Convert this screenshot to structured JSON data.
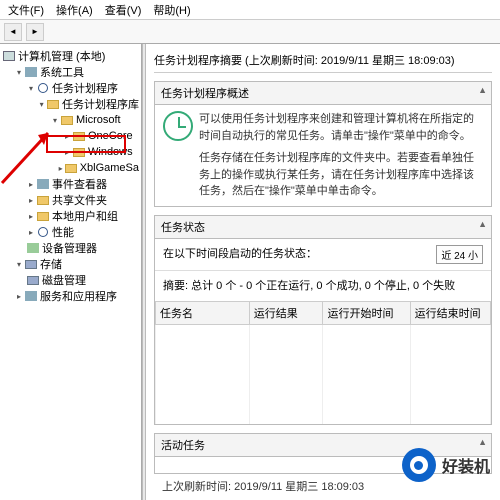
{
  "menu": {
    "file": "文件(F)",
    "action": "操作(A)",
    "view": "查看(V)",
    "help": "帮助(H)"
  },
  "tree": {
    "root": "计算机管理 (本地)",
    "system_tools": "系统工具",
    "task_scheduler": "任务计划程序",
    "task_scheduler_lib": "任务计划程序库",
    "microsoft": "Microsoft",
    "onecore": "OneCore",
    "windows": "Windows",
    "xblgamesa": "XblGameSa",
    "event_viewer": "事件查看器",
    "shared_folders": "共享文件夹",
    "local_users": "本地用户和组",
    "performance": "性能",
    "device_manager": "设备管理器",
    "storage": "存储",
    "disk_mgmt": "磁盘管理",
    "services_apps": "服务和应用程序"
  },
  "content": {
    "summary_title": "任务计划程序摘要 (上次刷新时间: 2019/9/11 星期三 18:09:03)",
    "overview_header": "任务计划程序概述",
    "overview_p1": "可以使用任务计划程序来创建和管理计算机将在所指定的时间自动执行的常见任务。请单击\"操作\"菜单中的命令。",
    "overview_p2": "任务存储在任务计划程序库的文件夹中。若要查看单独任务上的操作或执行某任务，请在任务计划程序库中选择该任务，然后在\"操作\"菜单中单击命令。",
    "status_header": "任务状态",
    "status_label": "在以下时间段启动的任务状态：",
    "status_filter": "近 24 小",
    "status_summary": "摘要: 总计 0 个 - 0 个正在运行, 0 个成功, 0 个停止, 0 个失败",
    "col_task_name": "任务名",
    "col_run_result": "运行结果",
    "col_start_time": "运行开始时间",
    "col_end_time": "运行结束时间",
    "active_header": "活动任务",
    "last_refresh": "上次刷新时间: 2019/9/11 星期三 18:09:03"
  },
  "watermark": {
    "text": "好装机"
  },
  "icons": {
    "pc": "pc-icon",
    "tools": "tools-icon",
    "clock": "clock-icon",
    "folder": "folder-icon",
    "event": "event-icon",
    "shared": "shared-icon",
    "users": "users-icon",
    "perf": "perf-icon",
    "dev": "dev-icon",
    "storage": "storage-icon",
    "disk": "disk-icon",
    "svc": "svc-icon"
  }
}
